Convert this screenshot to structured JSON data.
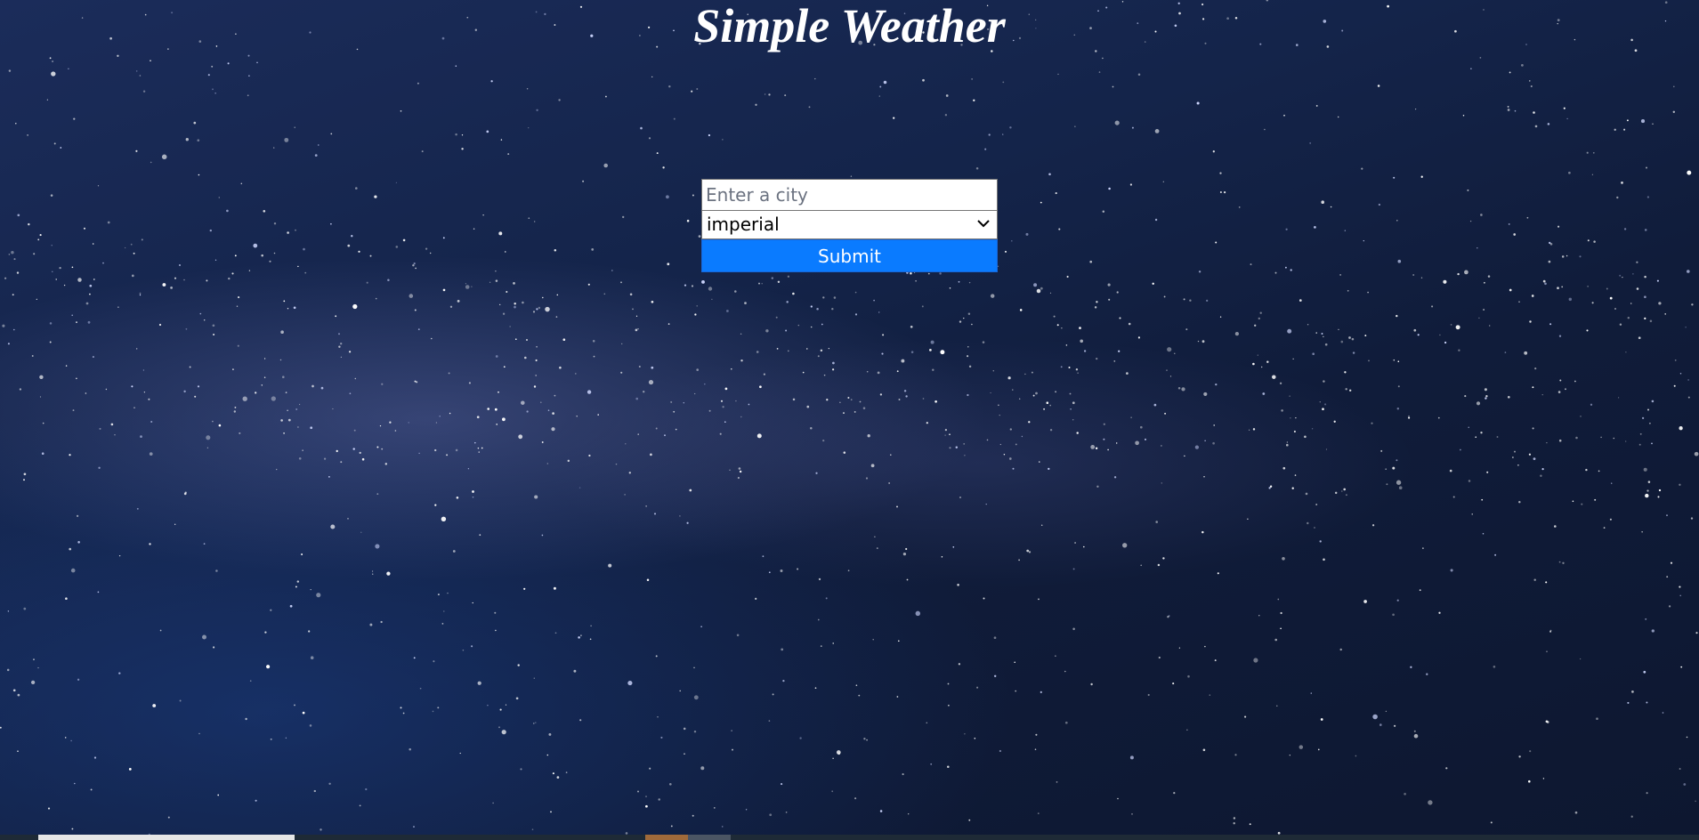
{
  "app": {
    "title": "Simple Weather"
  },
  "form": {
    "city_placeholder": "Enter a city",
    "city_value": "",
    "unit_selected": "imperial",
    "submit_label": "Submit"
  },
  "icons": {
    "select_arrow": "chevron-down-icon"
  },
  "colors": {
    "submit_bg": "#0a7bff",
    "title_text": "#ffffff"
  }
}
